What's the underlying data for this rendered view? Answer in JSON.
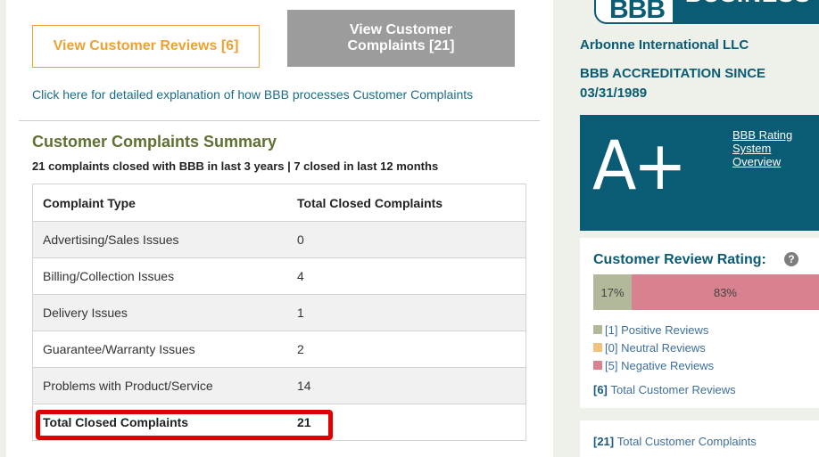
{
  "main": {
    "reviews_button": "View Customer Reviews [6]",
    "complaints_button": "View Customer Complaints [21]",
    "explain_link": "Click here for detailed explanation of how BBB processes Customer Complaints",
    "summary_title": "Customer Complaints Summary",
    "summary_subtitle": "21 complaints closed with BBB in last 3 years | 7 closed in last 12 months",
    "table": {
      "headers": [
        "Complaint Type",
        "Total Closed Complaints"
      ],
      "rows": [
        {
          "type": "Advertising/Sales Issues",
          "count": "0"
        },
        {
          "type": "Billing/Collection Issues",
          "count": "4"
        },
        {
          "type": "Delivery Issues",
          "count": "1"
        },
        {
          "type": "Guarantee/Warranty Issues",
          "count": "2"
        },
        {
          "type": "Problems with Product/Service",
          "count": "14"
        }
      ],
      "total_label": "Total Closed Complaints",
      "total_value": "21"
    },
    "highlight_color": "#e00000"
  },
  "sidebar": {
    "logo_text": "BBB",
    "logo_word": "BUSINESS",
    "business_name": "Arbonne International LLC",
    "accreditation": "BBB ACCREDITATION SINCE 03/31/1989",
    "rating": "A+",
    "rating_link": "BBB Rating System Overview",
    "review_rating_title": "Customer Review Rating:",
    "help_icon": "?",
    "review_bar": [
      {
        "label": "17%",
        "percent": 17,
        "color": "#b1b99a"
      },
      {
        "label": "",
        "percent": 0,
        "color": "#f3c17e"
      },
      {
        "label": "83%",
        "percent": 83,
        "color": "#d8818f"
      }
    ],
    "legend": [
      {
        "count": "[1]",
        "label": "Positive Reviews",
        "color": "#b1b99a"
      },
      {
        "count": "[0]",
        "label": "Neutral Reviews",
        "color": "#f3c17e"
      },
      {
        "count": "[5]",
        "label": "Negative Reviews",
        "color": "#d8818f"
      }
    ],
    "total_reviews_count": "[6]",
    "total_reviews_label": "Total Customer Reviews",
    "total_complaints_count": "[21]",
    "total_complaints_label": "Total Customer Complaints",
    "brand_color": "#0a5b74"
  }
}
